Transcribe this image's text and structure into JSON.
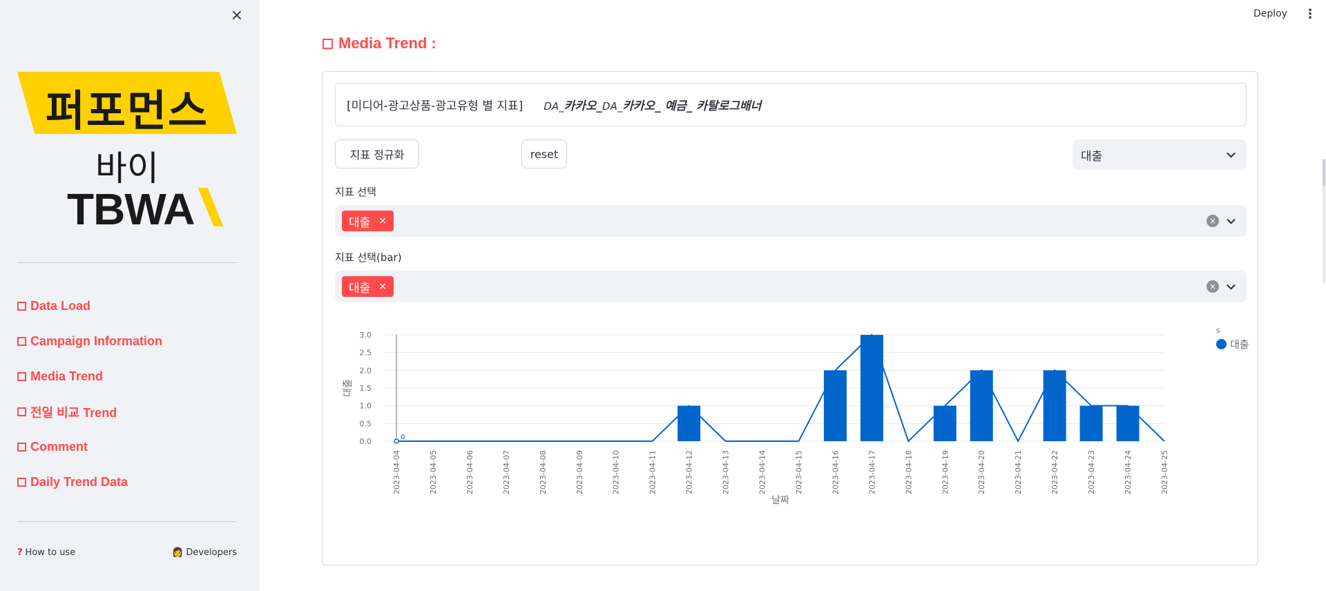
{
  "sidebar": {
    "close_glyph": "×",
    "logo": {
      "title": "퍼포먼스",
      "by": "바이",
      "brand": "TBWA"
    },
    "nav": [
      {
        "label": "Data Load"
      },
      {
        "label": "Campaign Information"
      },
      {
        "label": "Media Trend"
      },
      {
        "label": "전일 비교 Trend"
      },
      {
        "label": "Comment"
      },
      {
        "label": "Daily Trend Data"
      }
    ],
    "footer": {
      "how_to_use": "How to use",
      "how_icon": "?",
      "developers": "Developers",
      "dev_icon": "👩"
    }
  },
  "topbar": {
    "deploy": "Deploy",
    "menu_glyph": "⋮"
  },
  "section": {
    "title": "Media Trend :"
  },
  "info": {
    "label": "[미디어-광고상품-광고유형 별 지표]",
    "value_parts": [
      "DA_",
      "카카오_",
      "DA_",
      "카카오_ 예금_ 카탈로그배너"
    ]
  },
  "buttons": {
    "normalize": "지표 정규화",
    "reset": "reset"
  },
  "metric_select": {
    "value": "대출"
  },
  "multiselect_line": {
    "label": "지표 선택",
    "tag": "대출",
    "tag_x": "×",
    "clear": "×"
  },
  "multiselect_bar": {
    "label": "지표 선택(bar)",
    "tag": "대출",
    "tag_x": "×",
    "clear": "×"
  },
  "colors": {
    "accent": "#ff4b4b",
    "series": "#0066cc",
    "sidebar_bg": "#f0f2f6"
  },
  "chart_data": {
    "type": "bar",
    "xlabel": "날짜",
    "ylabel": "대출",
    "ylim": [
      0,
      3.0
    ],
    "yticks": [
      "0.0",
      "0.5",
      "1.0",
      "1.5",
      "2.0",
      "2.5",
      "3.0"
    ],
    "categories": [
      "2023-04-04",
      "2023-04-05",
      "2023-04-06",
      "2023-04-07",
      "2023-04-08",
      "2023-04-09",
      "2023-04-10",
      "2023-04-11",
      "2023-04-12",
      "2023-04-13",
      "2023-04-14",
      "2023-04-15",
      "2023-04-16",
      "2023-04-17",
      "2023-04-18",
      "2023-04-19",
      "2023-04-20",
      "2023-04-21",
      "2023-04-22",
      "2023-04-23",
      "2023-04-24",
      "2023-04-25"
    ],
    "series": [
      {
        "name": "대출",
        "kind": "bar",
        "values": [
          0,
          0,
          0,
          0,
          0,
          0,
          0,
          0,
          1,
          0,
          0,
          0,
          2,
          3,
          0,
          1,
          2,
          0,
          2,
          1,
          1,
          0
        ]
      },
      {
        "name": "대출",
        "kind": "line",
        "values": [
          0,
          0,
          0,
          0,
          0,
          0,
          0,
          0,
          1,
          0,
          0,
          0,
          2,
          3,
          0,
          1,
          2,
          0,
          2,
          1,
          1,
          0
        ]
      }
    ],
    "first_point_label": "0",
    "legend": {
      "title": "s",
      "items": [
        "대출"
      ],
      "position": "right"
    }
  }
}
